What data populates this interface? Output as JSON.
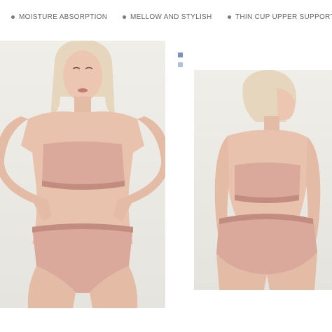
{
  "features": [
    {
      "label": "MOISTURE ABSORPTION"
    },
    {
      "label": "MELLOW AND STYLISH"
    },
    {
      "label": "THIN CUP UPPER SUPPORT"
    }
  ],
  "colors": {
    "text": "#666666",
    "product": "#dba99c",
    "product_shadow": "#c28d80",
    "skin": "#e9c2ad",
    "hair": "#e6d6bd",
    "square_1": "#7b8fc7",
    "square_2": "#b3bfe0"
  },
  "photos": [
    {
      "view": "front"
    },
    {
      "view": "back"
    }
  ]
}
